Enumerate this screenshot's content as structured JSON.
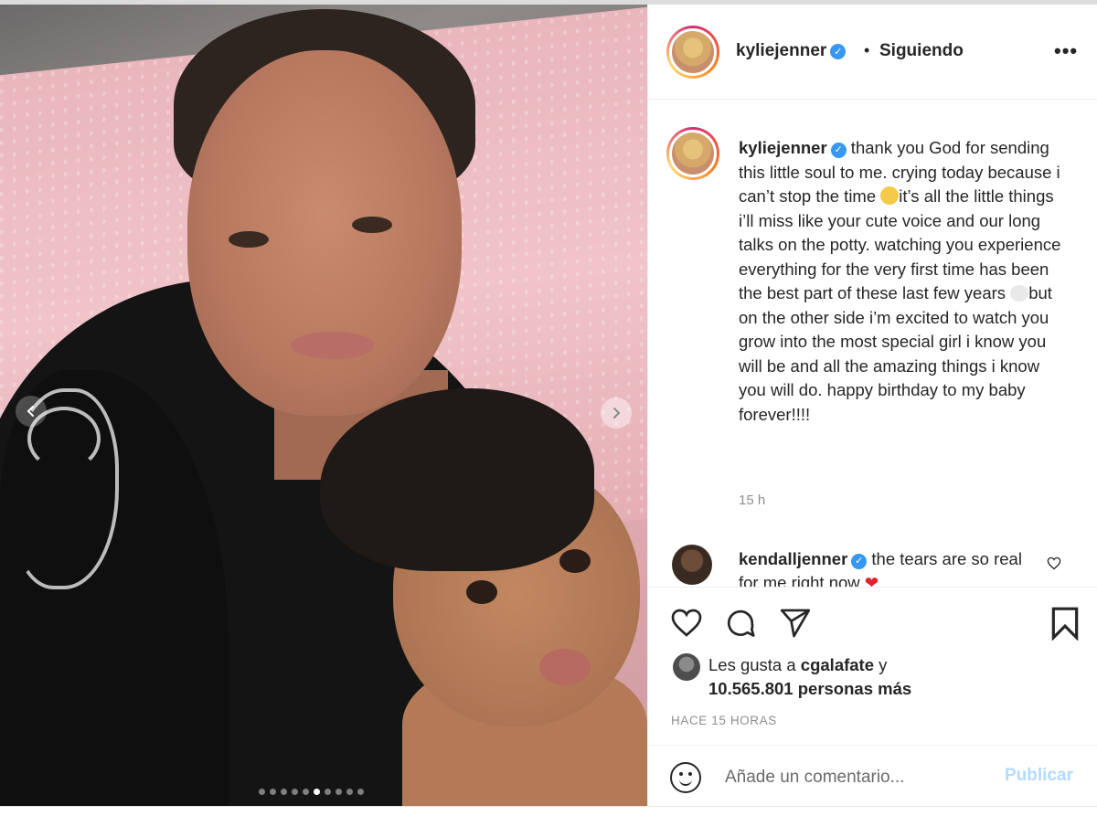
{
  "post": {
    "author": {
      "username": "kyliejenner",
      "verified": true,
      "follow_status": "Siguiendo",
      "separator": "•",
      "more_label": "•••"
    },
    "caption": {
      "username": "kyliejenner",
      "text_part1": " thank you God for sending this little soul to me. crying today because i can’t stop the time ",
      "text_part2": "it’s all the little things i’ll miss like your cute voice and our long talks on the potty. watching you experience everything for the very first time has been the best part of these last few years ",
      "text_part3": "but on the other side i’m excited to watch you grow into the most special girl i know you will be and all the amazing things i know you will do. happy birthday to my baby forever!!!!",
      "timestamp": "15 h"
    },
    "comment": {
      "username": "kendalljenner",
      "verified": true,
      "text": " the tears are so real for me right now ",
      "emoji": "❤"
    },
    "likes": {
      "prefix": "Les gusta a ",
      "first_user": "cgalafate",
      "suffix": " y",
      "others": "10.565.801 personas más"
    },
    "time_ago": "HACE 15 HORAS",
    "add_comment": {
      "placeholder": "Añade un comentario...",
      "publish_label": "Publicar"
    },
    "carousel": {
      "total_slides": 10,
      "active_index": 5
    }
  },
  "icons": {
    "verified": "verified-badge-icon",
    "like": "heart-icon",
    "comment": "comment-bubble-icon",
    "share": "paper-plane-icon",
    "save": "bookmark-icon",
    "emoji": "smiley-icon",
    "prev": "chevron-left-icon",
    "next": "chevron-right-icon"
  },
  "colors": {
    "verified": "#3897f0",
    "publish_disabled": "#b3dbff",
    "heart": "#e0242f"
  }
}
